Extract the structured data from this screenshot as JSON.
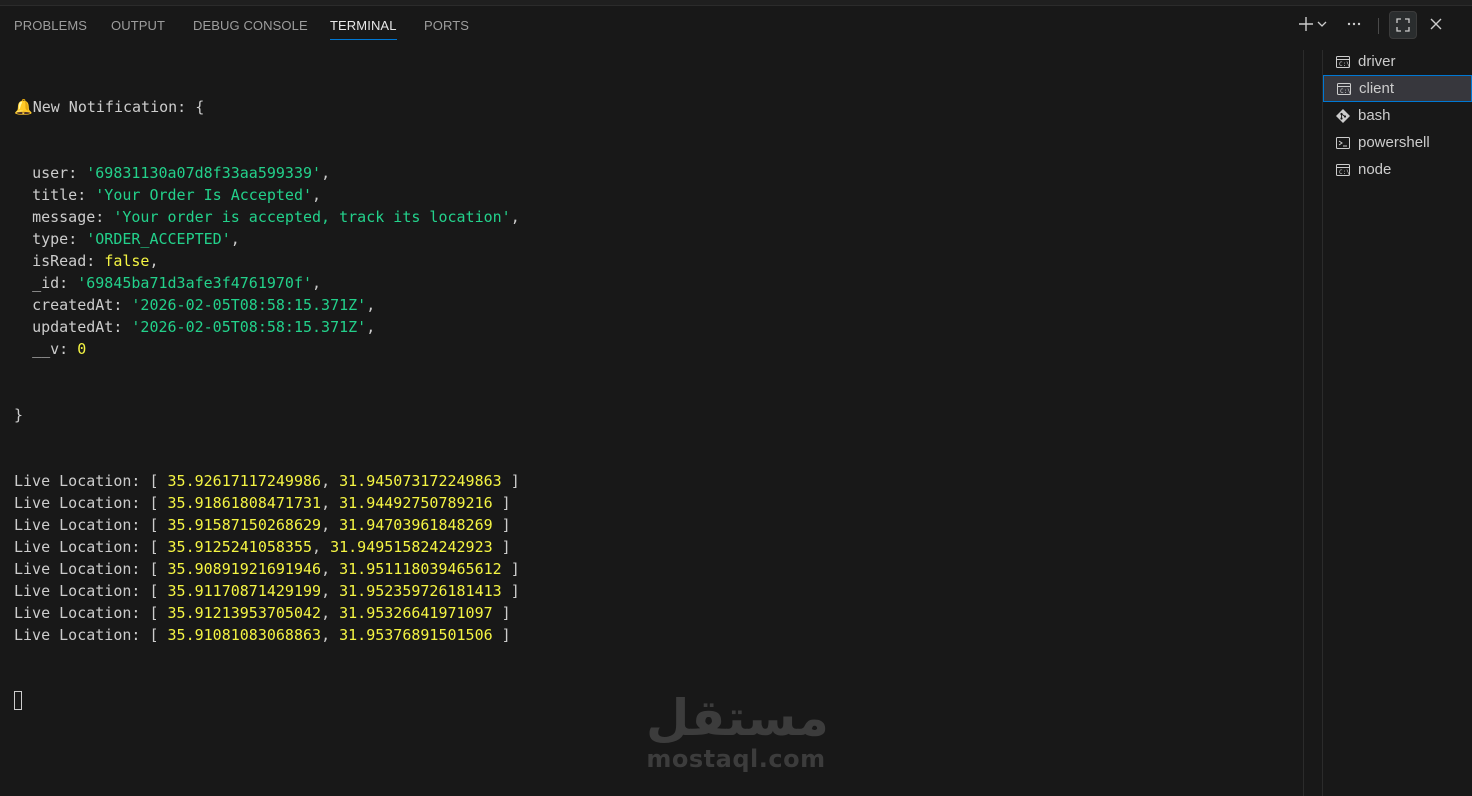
{
  "tabs": [
    {
      "label": "PROBLEMS",
      "active": false
    },
    {
      "label": "OUTPUT",
      "active": false
    },
    {
      "label": "DEBUG CONSOLE",
      "active": false
    },
    {
      "label": "TERMINAL",
      "active": true
    },
    {
      "label": "PORTS",
      "active": false
    }
  ],
  "actions": [
    "new-terminal-icon",
    "chevron-down-icon",
    "more-icon",
    "maximize-icon",
    "close-icon"
  ],
  "terminal": {
    "notification_header": "New Notification: {",
    "fields": [
      {
        "key": "user",
        "value": "'69831130a07d8f33aa599339'",
        "kind": "str"
      },
      {
        "key": "title",
        "value": "'Your Order Is Accepted'",
        "kind": "str"
      },
      {
        "key": "message",
        "value": "'Your order is accepted, track its location'",
        "kind": "str"
      },
      {
        "key": "type",
        "value": "'ORDER_ACCEPTED'",
        "kind": "str"
      },
      {
        "key": "isRead",
        "value": "false",
        "kind": "bool"
      },
      {
        "key": "_id",
        "value": "'69845ba71d3afe3f4761970f'",
        "kind": "str"
      },
      {
        "key": "createdAt",
        "value": "'2026-02-05T08:58:15.371Z'",
        "kind": "str"
      },
      {
        "key": "updatedAt",
        "value": "'2026-02-05T08:58:15.371Z'",
        "kind": "str"
      },
      {
        "key": "__v",
        "value": "0",
        "kind": "num"
      }
    ],
    "closing_brace": "}",
    "location_label": "Live Location:",
    "locations": [
      [
        "35.92617117249986",
        "31.945073172249863"
      ],
      [
        "35.91861808471731",
        "31.94492750789216"
      ],
      [
        "35.91587150268629",
        "31.94703961848269"
      ],
      [
        "35.9125241058355",
        "31.949515824242923"
      ],
      [
        "35.90891921691946",
        "31.951118039465612"
      ],
      [
        "35.91170871429199",
        "31.952359726181413"
      ],
      [
        "35.91213953705042",
        "31.95326641971097"
      ],
      [
        "35.91081083068863",
        "31.95376891501506"
      ]
    ]
  },
  "sessions": [
    {
      "label": "driver",
      "icon": "cmd-icon",
      "active": false
    },
    {
      "label": "client",
      "icon": "cmd-icon",
      "active": true
    },
    {
      "label": "bash",
      "icon": "git-bash-icon",
      "active": false
    },
    {
      "label": "powershell",
      "icon": "powershell-icon",
      "active": false
    },
    {
      "label": "node",
      "icon": "cmd-icon",
      "active": false
    }
  ],
  "watermark": {
    "arabic": "مستقل",
    "latin": "mostaql.com"
  },
  "colors": {
    "background": "#181818",
    "accent": "#0078d4",
    "string": "#23d18b",
    "number": "#f5f543"
  }
}
